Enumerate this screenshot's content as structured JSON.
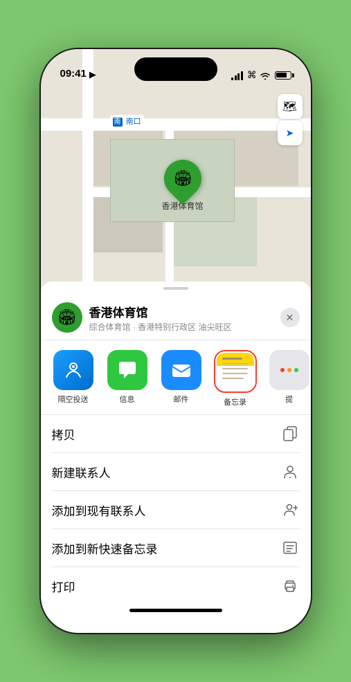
{
  "status": {
    "time": "09:41",
    "location_arrow": "▶"
  },
  "map": {
    "south_entrance_label": "南口",
    "location_name": "香港体育馆"
  },
  "map_controls": {
    "map_icon": "🗺",
    "location_icon": "➤"
  },
  "sheet": {
    "venue_icon": "🏟",
    "venue_name": "香港体育馆",
    "venue_desc": "综合体育馆 · 香港特别行政区 油尖旺区",
    "close_label": "✕"
  },
  "share_items": [
    {
      "label": "隔空投送",
      "type": "airdrop"
    },
    {
      "label": "信息",
      "type": "messages"
    },
    {
      "label": "邮件",
      "type": "mail"
    },
    {
      "label": "备忘录",
      "type": "notes"
    },
    {
      "label": "提",
      "type": "more"
    }
  ],
  "actions": [
    {
      "label": "拷贝",
      "icon": "copy"
    },
    {
      "label": "新建联系人",
      "icon": "person"
    },
    {
      "label": "添加到现有联系人",
      "icon": "add-person"
    },
    {
      "label": "添加到新快速备忘录",
      "icon": "note"
    },
    {
      "label": "打印",
      "icon": "print"
    }
  ]
}
